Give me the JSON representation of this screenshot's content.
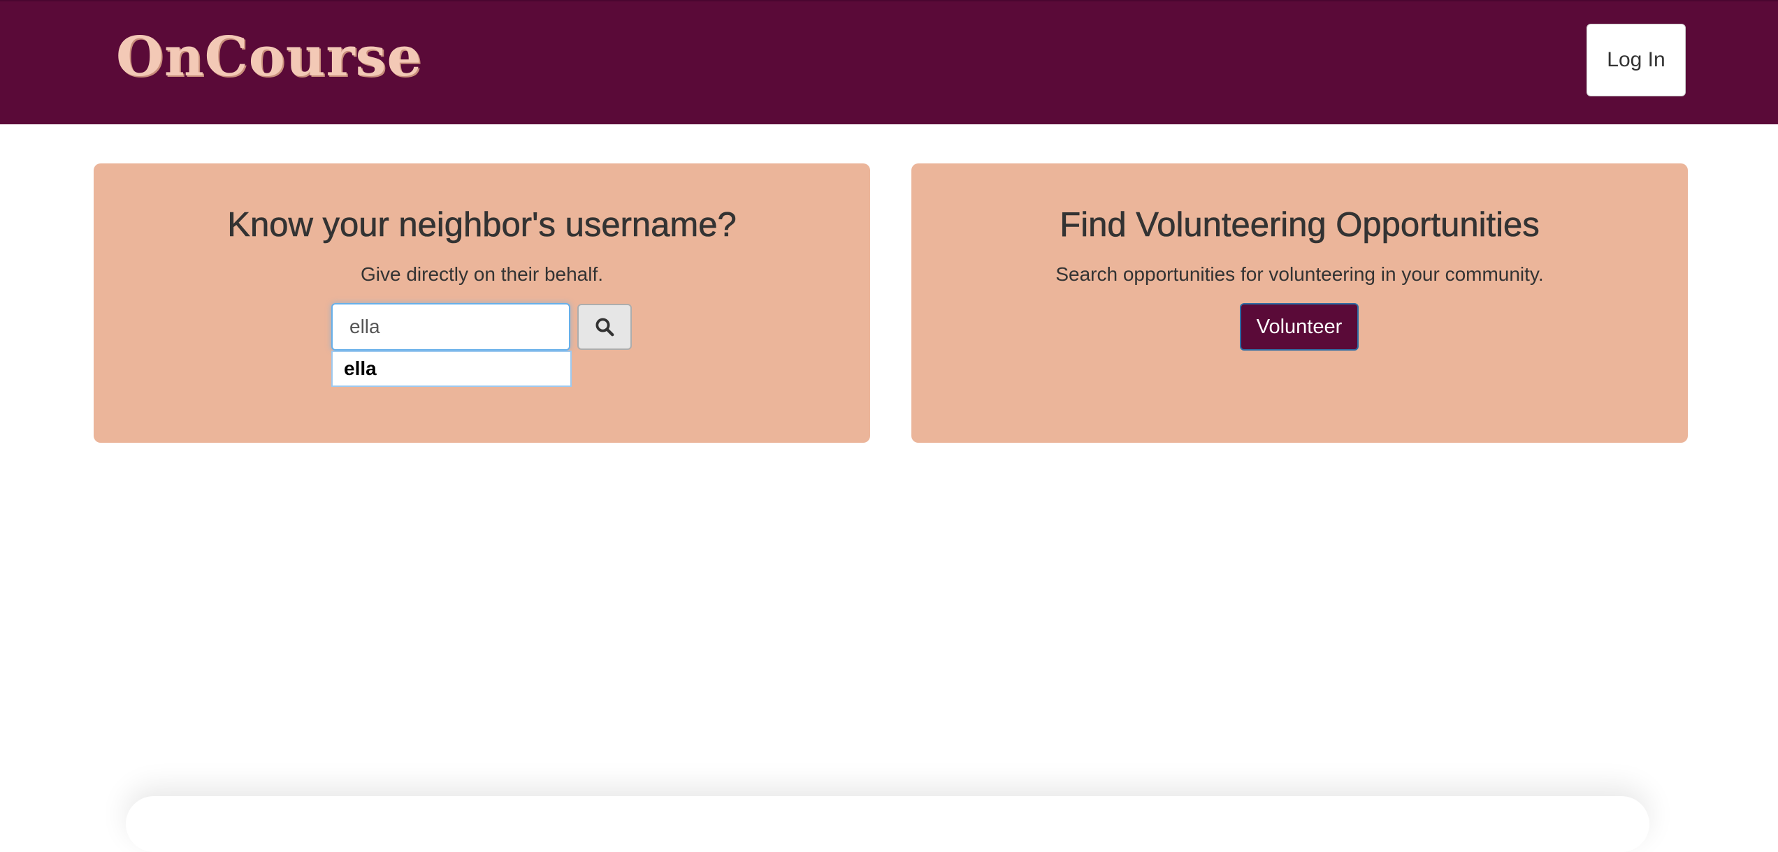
{
  "header": {
    "logo_text": "OnCourse",
    "login_label": "Log In",
    "background_color": "#5a0a38"
  },
  "neighbor_card": {
    "title": "Know your neighbor's username?",
    "subtitle": "Give directly on their behalf.",
    "search_value": "ella",
    "search_icon": "search-icon",
    "suggestions": [
      "ella"
    ]
  },
  "volunteer_card": {
    "title": "Find Volunteering Opportunities",
    "subtitle": "Search opportunities for volunteering in your community.",
    "button_label": "Volunteer"
  },
  "colors": {
    "card_background": "#ebb59a",
    "accent": "#5a0a38"
  }
}
